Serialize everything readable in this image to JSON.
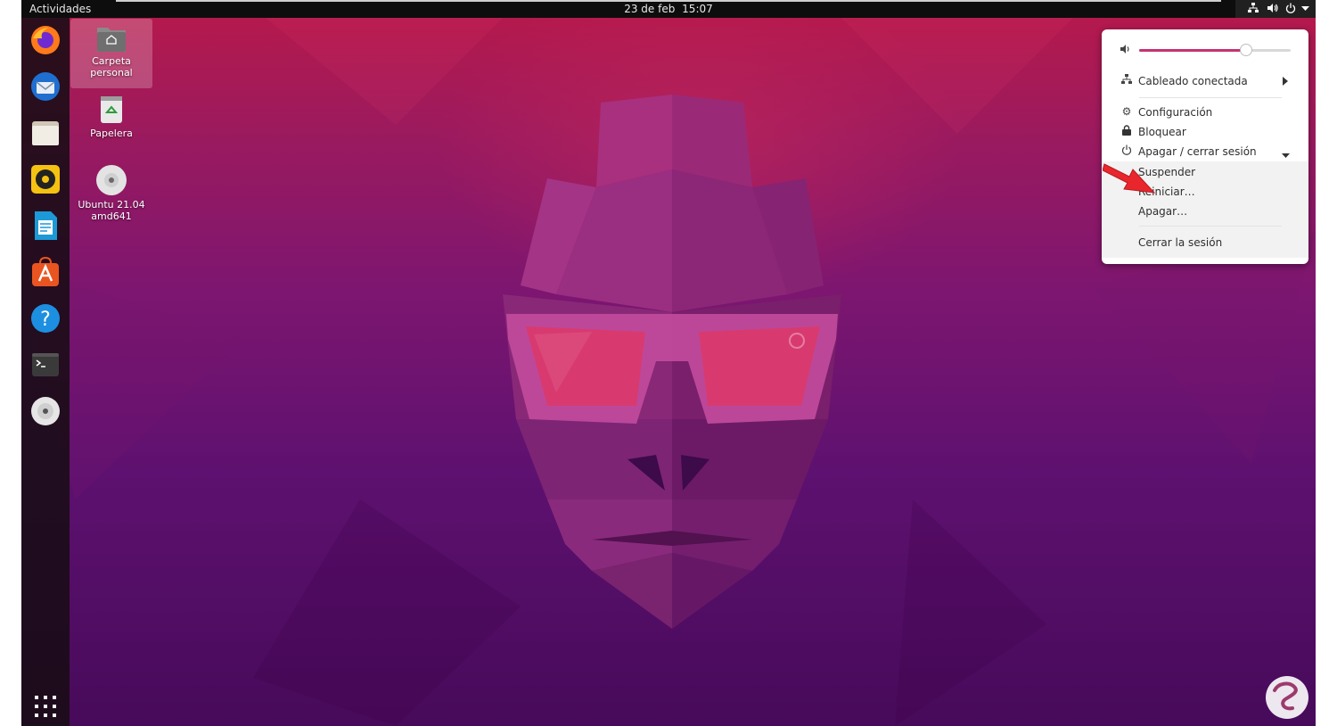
{
  "topbar": {
    "activities": "Actividades",
    "date": "23 de feb",
    "time": "15:07"
  },
  "tray_icons": [
    "network-icon",
    "volume-icon",
    "power-icon",
    "chevron-down-icon"
  ],
  "dock": {
    "apps": [
      {
        "name": "firefox-icon"
      },
      {
        "name": "thunderbird-icon"
      },
      {
        "name": "files-icon"
      },
      {
        "name": "rhythmbox-icon"
      },
      {
        "name": "libreoffice-writer-icon"
      },
      {
        "name": "software-center-icon"
      },
      {
        "name": "help-icon"
      },
      {
        "name": "terminal-icon"
      },
      {
        "name": "dvd-icon"
      }
    ],
    "app_grid": "show-applications-icon"
  },
  "desktop": {
    "icons": [
      {
        "line1": "Carpeta",
        "line2": "personal"
      },
      {
        "line1": "Papelera",
        "line2": ""
      },
      {
        "line1": "Ubuntu 21.04",
        "line2": "amd641"
      }
    ]
  },
  "system_menu": {
    "volume_level": 0.7,
    "network": "Cableado conectada",
    "settings": "Configuración",
    "lock": "Bloquear",
    "power_off_logout": "Apagar / cerrar sesión",
    "suspend": "Suspender",
    "restart": "Reiniciar…",
    "power_off": "Apagar…",
    "logout": "Cerrar la sesión"
  },
  "colors": {
    "accent": "#c43273",
    "arrow": "#e8262c",
    "topbar": "#0d0d0d"
  }
}
